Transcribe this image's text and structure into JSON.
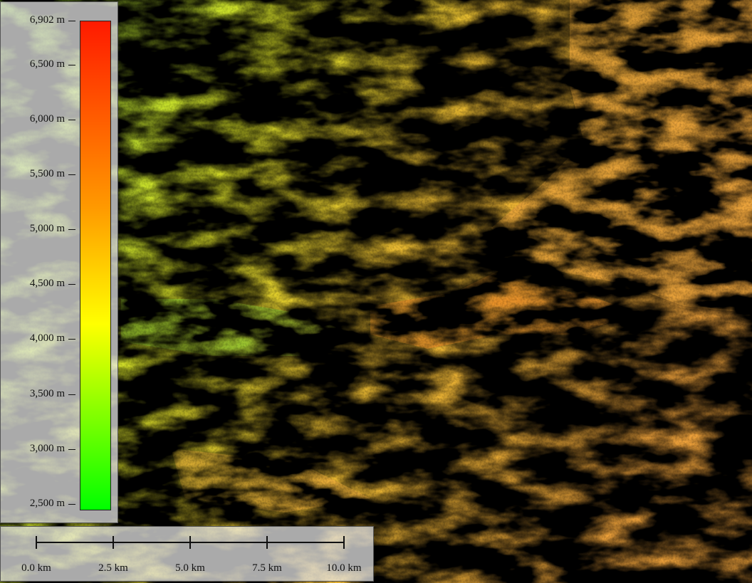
{
  "legend": {
    "unit": "m",
    "max_label": "6,902 m",
    "ticks": [
      {
        "label": "6,902 m",
        "value": 6902
      },
      {
        "label": "6,500 m",
        "value": 6500
      },
      {
        "label": "6,000 m",
        "value": 6000
      },
      {
        "label": "5,500 m",
        "value": 5500
      },
      {
        "label": "5,000 m",
        "value": 5000
      },
      {
        "label": "4,500 m",
        "value": 4500
      },
      {
        "label": "4,000 m",
        "value": 4000
      },
      {
        "label": "3,500 m",
        "value": 3500
      },
      {
        "label": "3,000 m",
        "value": 3000
      },
      {
        "label": "2,500 m",
        "value": 2500
      }
    ],
    "min_value": 2440,
    "max_value": 6902,
    "colors": {
      "low": "#00ff00",
      "mid": "#ffff00",
      "midhigh": "#ff9900",
      "high": "#ff1a00"
    }
  },
  "scale_bar": {
    "labels": [
      "0.0 km",
      "2.5 km",
      "5.0 km",
      "7.5 km",
      "10.0 km"
    ],
    "values_km": [
      0,
      2.5,
      5.0,
      7.5,
      10.0
    ]
  },
  "map": {
    "type": "shaded-relief elevation map",
    "colors": {
      "shadow": "#000000",
      "lowland": "#7ccf2a",
      "midland": "#e0e020",
      "highland": "#e99a2c",
      "peak": "#e05a10"
    }
  }
}
